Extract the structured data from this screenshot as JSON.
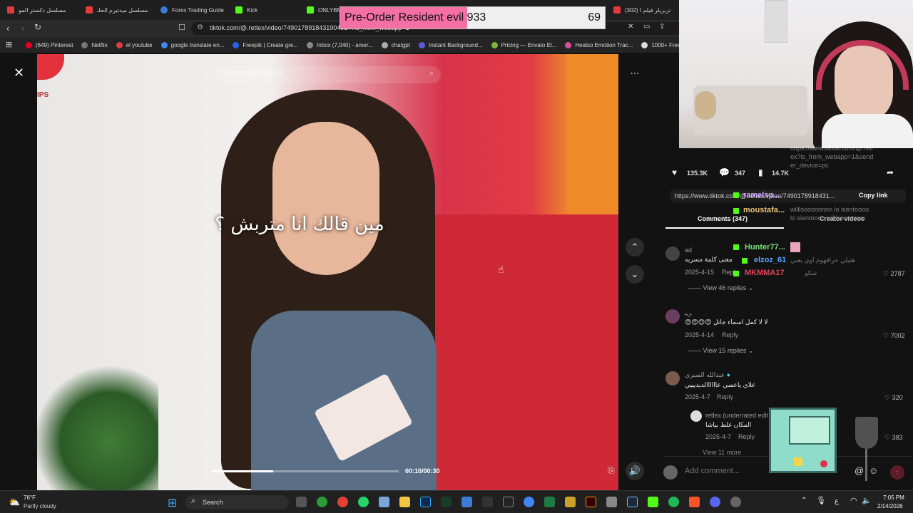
{
  "tabs": [
    {
      "label": "مسلسل دكستر المو",
      "color": "#e23b3b"
    },
    {
      "label": "مسلسل ميدتيرم الحلـ",
      "color": "#e23b3b"
    },
    {
      "label": "Forex Trading Guide",
      "color": "#3d7bd9"
    },
    {
      "label": "Kick",
      "color": "#53fc18"
    },
    {
      "label": "ONLYBMO",
      "color": "#53fc18"
    },
    {
      "label": "(302) تريزيلر فيلم ا",
      "color": "#e23b3b"
    }
  ],
  "address": {
    "url": "tiktok.com/@.retlex/video/7490178918431904914?is_from_webapp=1"
  },
  "bookmarks": [
    {
      "label": "(649) Pinterest",
      "color": "#e60023"
    },
    {
      "label": "Netflix",
      "color": "#999999"
    },
    {
      "label": "el youtube",
      "color": "#e23b3b"
    },
    {
      "label": "google translate en...",
      "color": "#4285f4"
    },
    {
      "label": "Freepik | Create gre...",
      "color": "#2563eb"
    },
    {
      "label": "Inbox (7,040) - amer...",
      "color": "#888888"
    },
    {
      "label": "chatgpt",
      "color": "#aaaaaa"
    },
    {
      "label": "Instant Background...",
      "color": "#5b5bd6"
    },
    {
      "label": "Pricing — Envato El...",
      "color": "#81b441"
    },
    {
      "label": "Healso Emotion Trac...",
      "color": "#d94f9b"
    },
    {
      "label": "1000+ Free",
      "color": "#dddddd"
    }
  ],
  "overlay": {
    "title": "Pre-Order Resident evil 9",
    "progress_value": "33",
    "count": "69",
    "progress_fraction": 0.48
  },
  "video": {
    "find_placeholder": "Find related content",
    "subtitle": "مين قالك انا متربش ؟",
    "brand": "IPS",
    "time": "00:10/00:30",
    "progress_fraction": 0.33
  },
  "stats": {
    "likes": "135.3K",
    "comments": "347",
    "saves": "14.7K"
  },
  "share": {
    "link": "https://www.tiktok.com/@.retlex/video/7490178918431...",
    "copy_label": "Copy link"
  },
  "panel_tabs": {
    "comments": "Comments (347)",
    "creator": "Creator videos"
  },
  "chat": [
    {
      "name": "ramelsp...",
      "color": "#cfa6ff",
      "text": "https://www.tiktok.com/@.retlex?is_from_webapp=1&sender_device=pc"
    },
    {
      "name": "moustafa...",
      "color": "#e8c27a",
      "text": "willisoooonnnn lo sientoooo lo sientoooo willisoonnnnn"
    },
    {
      "name": "Hunter77...",
      "color": "#79e07c",
      "text": ""
    },
    {
      "name": "elzoz_61",
      "color": "#5aa9ff",
      "text": "هتيلي حراقهوم اوي يعني"
    },
    {
      "name": "MKMMA17",
      "color": "#e8415a",
      "text": "شكو"
    }
  ],
  "comments": [
    {
      "user": "ad",
      "text": "معنى كلمة مسريه",
      "date": "2025-4-15",
      "reply": "Reply",
      "likes": "2787",
      "replies": "View 46 replies"
    },
    {
      "user": "ﻦﻴ",
      "text": "لا لا كمل اسماء جاتل 😍😍😍😍",
      "date": "2025-4-14",
      "reply": "Reply",
      "likes": "7002",
      "replies": "View 15 replies"
    },
    {
      "user": "عبدالله الصبري",
      "text": "علاي ياعصي عاااااالديديييي",
      "date": "2025-4-7",
      "reply": "Reply",
      "likes": "320",
      "replies": ""
    },
    {
      "user": "retlex (underrated edit",
      "text": "المكان غلط بياشا",
      "date": "2025-4-7",
      "reply": "Reply",
      "likes": "383",
      "replies": "View 11 more"
    }
  ],
  "add_comment": {
    "placeholder": "Add comment..."
  },
  "taskbar": {
    "weather_temp": "76°F",
    "weather_text": "Partly cloudy",
    "search_label": "Search",
    "time": "7:05 PM",
    "date": "2/14/2026",
    "lang": "ع"
  }
}
